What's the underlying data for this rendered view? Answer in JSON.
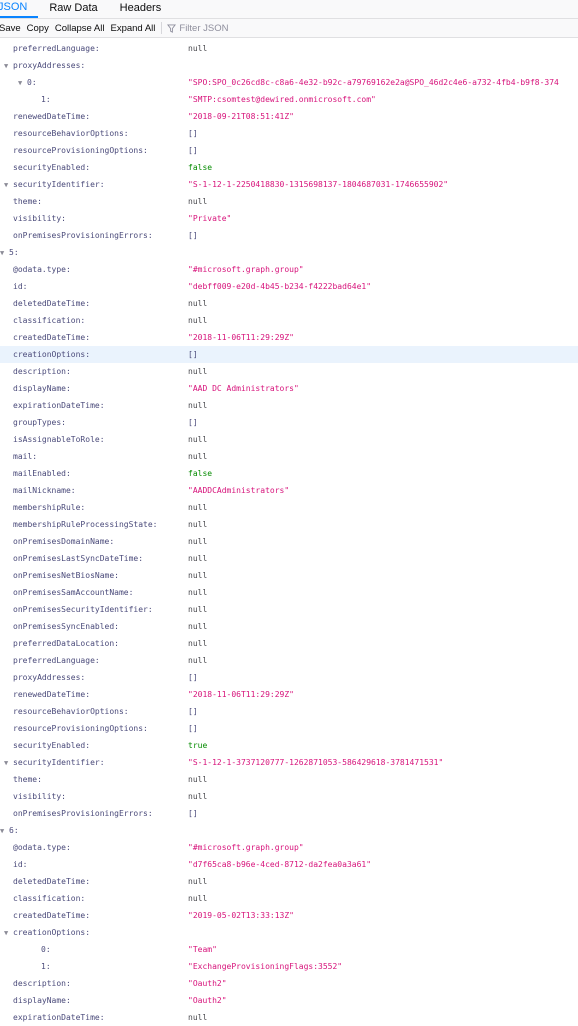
{
  "tabs": [
    "JSON",
    "Raw Data",
    "Headers"
  ],
  "toolbar": {
    "save": "Save",
    "copy": "Copy",
    "collapse_all": "Collapse All",
    "expand_all": "Expand All",
    "filter_placeholder": "Filter JSON"
  },
  "colors": {
    "accent": "#0a84ff",
    "string": "#d7137b",
    "boolean": "#058b00",
    "key": "#4a4a7a",
    "highlight": "#eaf3fd"
  },
  "rows": [
    {
      "level": 1,
      "key": "preferredLanguage:",
      "value": "null",
      "type": "null"
    },
    {
      "level": 1,
      "key": "proxyAddresses:",
      "value": "",
      "type": "expander",
      "toggle": "▼"
    },
    {
      "level": 2,
      "key": "0:",
      "value": "\"SPO:SPO_0c26cd8c-c8a6-4e32-b92c-a79769162e2a@SPO_46d2c4e6-a732-4fb4-b9f8-374",
      "type": "str",
      "toggle": "▼"
    },
    {
      "level": 3,
      "key": "1:",
      "value": "\"SMTP:csomtest@dewired.onmicrosoft.com\"",
      "type": "str"
    },
    {
      "level": 1,
      "key": "renewedDateTime:",
      "value": "\"2018-09-21T08:51:41Z\"",
      "type": "str"
    },
    {
      "level": 1,
      "key": "resourceBehaviorOptions:",
      "value": "[]",
      "type": "arr"
    },
    {
      "level": 1,
      "key": "resourceProvisioningOptions:",
      "value": "[]",
      "type": "arr"
    },
    {
      "level": 1,
      "key": "securityEnabled:",
      "value": "false",
      "type": "bool"
    },
    {
      "level": 1,
      "key": "securityIdentifier:",
      "value": "\"S-1-12-1-2250418830-1315698137-1804687031-1746655902\"",
      "type": "str",
      "toggle": "▼"
    },
    {
      "level": 1,
      "key": "theme:",
      "value": "null",
      "type": "null"
    },
    {
      "level": 1,
      "key": "visibility:",
      "value": "\"Private\"",
      "type": "str"
    },
    {
      "level": 1,
      "key": "onPremisesProvisioningErrors:",
      "value": "[]",
      "type": "arr"
    },
    {
      "level": 0,
      "key": "5:",
      "value": "",
      "type": "expander",
      "toggle": "▼"
    },
    {
      "level": 1,
      "key": "@odata.type:",
      "value": "\"#microsoft.graph.group\"",
      "type": "str"
    },
    {
      "level": 1,
      "key": "id:",
      "value": "\"debff009-e20d-4b45-b234-f4222bad64e1\"",
      "type": "str"
    },
    {
      "level": 1,
      "key": "deletedDateTime:",
      "value": "null",
      "type": "null"
    },
    {
      "level": 1,
      "key": "classification:",
      "value": "null",
      "type": "null"
    },
    {
      "level": 1,
      "key": "createdDateTime:",
      "value": "\"2018-11-06T11:29:29Z\"",
      "type": "str"
    },
    {
      "level": 1,
      "key": "creationOptions:",
      "value": "[]",
      "type": "arr",
      "highlight": true
    },
    {
      "level": 1,
      "key": "description:",
      "value": "null",
      "type": "null"
    },
    {
      "level": 1,
      "key": "displayName:",
      "value": "\"AAD DC Administrators\"",
      "type": "str"
    },
    {
      "level": 1,
      "key": "expirationDateTime:",
      "value": "null",
      "type": "null"
    },
    {
      "level": 1,
      "key": "groupTypes:",
      "value": "[]",
      "type": "arr"
    },
    {
      "level": 1,
      "key": "isAssignableToRole:",
      "value": "null",
      "type": "null"
    },
    {
      "level": 1,
      "key": "mail:",
      "value": "null",
      "type": "null"
    },
    {
      "level": 1,
      "key": "mailEnabled:",
      "value": "false",
      "type": "bool"
    },
    {
      "level": 1,
      "key": "mailNickname:",
      "value": "\"AADDCAdministrators\"",
      "type": "str"
    },
    {
      "level": 1,
      "key": "membershipRule:",
      "value": "null",
      "type": "null"
    },
    {
      "level": 1,
      "key": "membershipRuleProcessingState:",
      "value": "null",
      "type": "null"
    },
    {
      "level": 1,
      "key": "onPremisesDomainName:",
      "value": "null",
      "type": "null"
    },
    {
      "level": 1,
      "key": "onPremisesLastSyncDateTime:",
      "value": "null",
      "type": "null"
    },
    {
      "level": 1,
      "key": "onPremisesNetBiosName:",
      "value": "null",
      "type": "null"
    },
    {
      "level": 1,
      "key": "onPremisesSamAccountName:",
      "value": "null",
      "type": "null"
    },
    {
      "level": 1,
      "key": "onPremisesSecurityIdentifier:",
      "value": "null",
      "type": "null"
    },
    {
      "level": 1,
      "key": "onPremisesSyncEnabled:",
      "value": "null",
      "type": "null"
    },
    {
      "level": 1,
      "key": "preferredDataLocation:",
      "value": "null",
      "type": "null"
    },
    {
      "level": 1,
      "key": "preferredLanguage:",
      "value": "null",
      "type": "null"
    },
    {
      "level": 1,
      "key": "proxyAddresses:",
      "value": "[]",
      "type": "arr"
    },
    {
      "level": 1,
      "key": "renewedDateTime:",
      "value": "\"2018-11-06T11:29:29Z\"",
      "type": "str"
    },
    {
      "level": 1,
      "key": "resourceBehaviorOptions:",
      "value": "[]",
      "type": "arr"
    },
    {
      "level": 1,
      "key": "resourceProvisioningOptions:",
      "value": "[]",
      "type": "arr"
    },
    {
      "level": 1,
      "key": "securityEnabled:",
      "value": "true",
      "type": "bool"
    },
    {
      "level": 1,
      "key": "securityIdentifier:",
      "value": "\"S-1-12-1-3737120777-1262871053-586429618-3781471531\"",
      "type": "str",
      "toggle": "▼"
    },
    {
      "level": 1,
      "key": "theme:",
      "value": "null",
      "type": "null"
    },
    {
      "level": 1,
      "key": "visibility:",
      "value": "null",
      "type": "null"
    },
    {
      "level": 1,
      "key": "onPremisesProvisioningErrors:",
      "value": "[]",
      "type": "arr"
    },
    {
      "level": 0,
      "key": "6:",
      "value": "",
      "type": "expander",
      "toggle": "▼"
    },
    {
      "level": 1,
      "key": "@odata.type:",
      "value": "\"#microsoft.graph.group\"",
      "type": "str"
    },
    {
      "level": 1,
      "key": "id:",
      "value": "\"d7f65ca8-b96e-4ced-8712-da2fea0a3a61\"",
      "type": "str"
    },
    {
      "level": 1,
      "key": "deletedDateTime:",
      "value": "null",
      "type": "null"
    },
    {
      "level": 1,
      "key": "classification:",
      "value": "null",
      "type": "null"
    },
    {
      "level": 1,
      "key": "createdDateTime:",
      "value": "\"2019-05-02T13:33:13Z\"",
      "type": "str"
    },
    {
      "level": 1,
      "key": "creationOptions:",
      "value": "",
      "type": "expander",
      "toggle": "▼"
    },
    {
      "level": 3,
      "key": "0:",
      "value": "\"Team\"",
      "type": "str"
    },
    {
      "level": 3,
      "key": "1:",
      "value": "\"ExchangeProvisioningFlags:3552\"",
      "type": "str"
    },
    {
      "level": 1,
      "key": "description:",
      "value": "\"Oauth2\"",
      "type": "str"
    },
    {
      "level": 1,
      "key": "displayName:",
      "value": "\"Oauth2\"",
      "type": "str"
    },
    {
      "level": 1,
      "key": "expirationDateTime:",
      "value": "null",
      "type": "null"
    }
  ]
}
